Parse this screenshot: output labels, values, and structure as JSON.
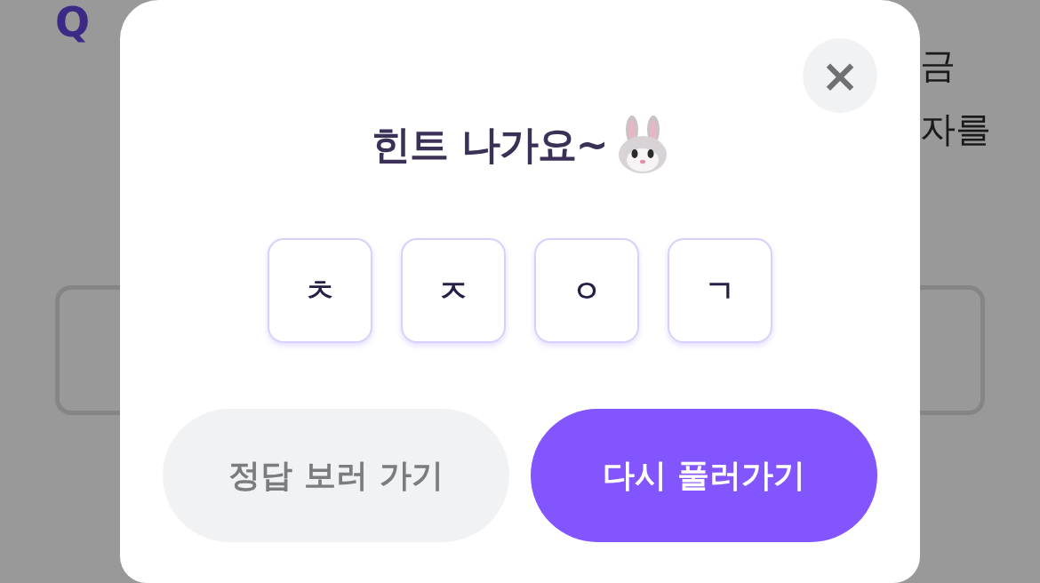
{
  "background": {
    "question_mark": "Q",
    "fragments": [
      "금",
      "자를"
    ]
  },
  "modal": {
    "title": "힌트 나가요~",
    "close": "×",
    "hints": [
      {
        "letter": "ㅊ"
      },
      {
        "letter": "ㅈ"
      },
      {
        "letter": "ㅇ"
      },
      {
        "letter": "ㄱ"
      }
    ],
    "buttons": [
      {
        "label": "정답 보러 가기",
        "kind": "secondary"
      },
      {
        "label": "다시 풀러가기",
        "kind": "primary"
      }
    ]
  }
}
